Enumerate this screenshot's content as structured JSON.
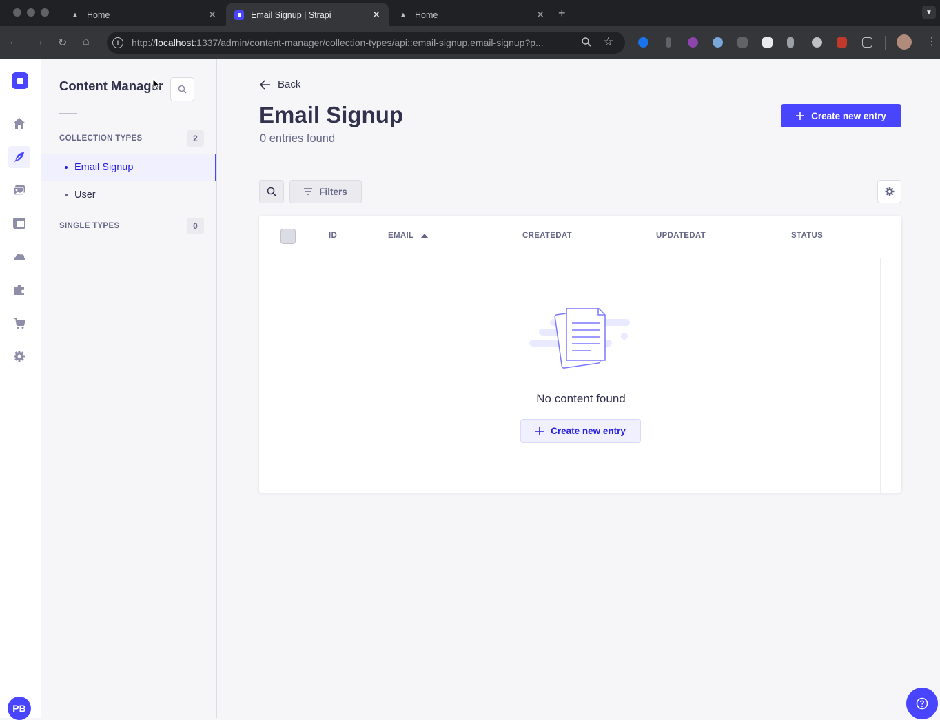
{
  "browser": {
    "tabs": [
      {
        "title": "Home",
        "active": false
      },
      {
        "title": "Email Signup | Strapi",
        "active": true
      },
      {
        "title": "Home",
        "active": false
      }
    ],
    "url_prefix": "http://",
    "url_host": "localhost",
    "url_rest": ":1337/admin/content-manager/collection-types/api::email-signup.email-signup?p...",
    "new_tab_label": "+"
  },
  "sidebar": {
    "title": "Content Manager",
    "collection_types_label": "COLLECTION TYPES",
    "collection_types_count": "2",
    "single_types_label": "SINGLE TYPES",
    "single_types_count": "0",
    "items": [
      {
        "label": "Email Signup",
        "active": true
      },
      {
        "label": "User",
        "active": false
      }
    ]
  },
  "mainnav": {
    "icons": [
      "home-icon",
      "content-manager-icon",
      "media-library-icon",
      "content-type-builder-icon",
      "cloud-icon",
      "plugins-icon",
      "marketplace-icon",
      "settings-icon"
    ],
    "avatar_initials": "PB"
  },
  "header": {
    "back_label": "Back",
    "title": "Email Signup",
    "subtitle": "0 entries found",
    "create_label": "Create new entry"
  },
  "actions": {
    "filters_label": "Filters"
  },
  "table": {
    "columns": [
      "ID",
      "EMAIL",
      "CREATEDAT",
      "UPDATEDAT",
      "STATUS"
    ],
    "sorted_column": "EMAIL",
    "sort_direction": "ascending",
    "empty_text": "No content found",
    "empty_create_label": "Create new entry"
  },
  "colors": {
    "primary": "#4945ff",
    "primary_light": "#f0f0ff",
    "text": "#32324d",
    "muted": "#666687"
  }
}
